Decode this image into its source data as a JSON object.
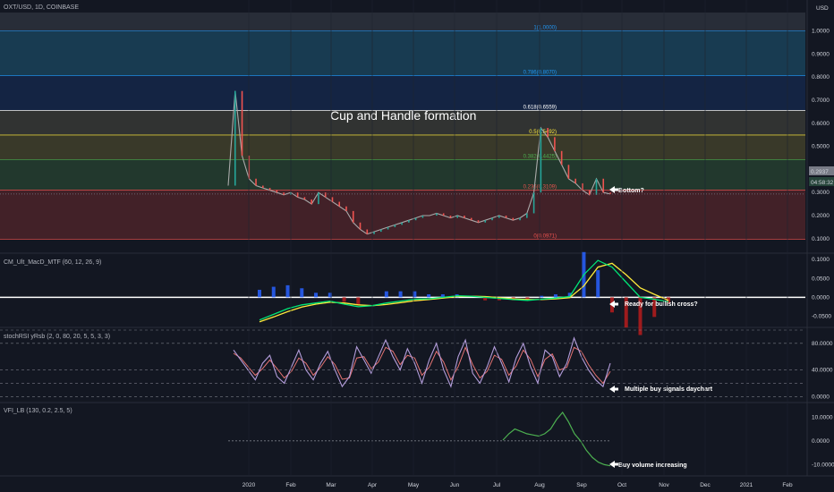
{
  "header": {
    "symbol": "OXT/USD, 1D, COINBASE",
    "currency": "USD"
  },
  "colors": {
    "bg": "#131722",
    "grid": "#1f2430",
    "price": "#aaaaaa",
    "candle_up": "#26a69a",
    "candle_down": "#ef5350",
    "macd_up": "#00e676",
    "macd_down": "#f44336",
    "signal": "#ffeb3b",
    "hist_pos": "#2962ff",
    "hist_neg": "#b71c1c",
    "stoch_k": "#b39ddb",
    "stoch_d": "#e57373",
    "vfi": "#4caf50"
  },
  "chart_data": [
    {
      "type": "line",
      "panel": "price",
      "title": "Cup and Handle formation",
      "y_ticks": [
        "1.0000",
        "0.9000",
        "0.8000",
        "0.7000",
        "0.6000",
        "0.5000",
        "0.4000",
        "0.3000",
        "0.2000",
        "0.1000"
      ],
      "ylim": [
        0.08,
        1.08
      ],
      "x_labels": [
        "2020",
        "Feb",
        "Mar",
        "Apr",
        "May",
        "Jun",
        "Jul",
        "Aug",
        "Sep",
        "Oct",
        "Nov",
        "Dec",
        "2021",
        "Feb"
      ],
      "fib_levels": [
        {
          "label": "1(1.0000)",
          "value": 1.0,
          "color": "#2196f3"
        },
        {
          "label": "0.786(0.8070)",
          "value": 0.807,
          "color": "#2196f3"
        },
        {
          "label": "0.618(0.6559)",
          "value": 0.6559,
          "color": "#ffffff"
        },
        {
          "label": "0.5(0.5492)",
          "value": 0.5492,
          "color": "#ffeb3b"
        },
        {
          "label": "0.382(0.4425)",
          "value": 0.4425,
          "color": "#4caf50"
        },
        {
          "label": "0.236(0.3109)",
          "value": 0.3109,
          "color": "#ef5350"
        },
        {
          "label": "0(0.0971)",
          "value": 0.0971,
          "color": "#ef5350"
        }
      ],
      "series": [
        {
          "values": [
            0.33,
            0.74,
            0.46,
            0.36,
            0.33,
            0.32,
            0.31,
            0.3,
            0.29,
            0.3,
            0.28,
            0.27,
            0.25,
            0.3,
            0.28,
            0.26,
            0.24,
            0.22,
            0.17,
            0.14,
            0.12,
            0.13,
            0.14,
            0.15,
            0.16,
            0.17,
            0.18,
            0.19,
            0.2,
            0.2,
            0.21,
            0.2,
            0.19,
            0.2,
            0.19,
            0.18,
            0.17,
            0.18,
            0.19,
            0.2,
            0.19,
            0.18,
            0.19,
            0.21,
            0.3,
            0.58,
            0.54,
            0.48,
            0.42,
            0.36,
            0.34,
            0.31,
            0.29,
            0.36,
            0.3,
            0.2937
          ]
        }
      ],
      "current_price": "0.2937",
      "countdown": "04:58:32",
      "annotation": "Bottom?"
    },
    {
      "type": "line",
      "panel": "macd",
      "title": "CM_Ult_MacD_MTF (60, 12, 26, 9)",
      "y_ticks": [
        "0.1000",
        "0.0500",
        "0.0000",
        "-0.0500"
      ],
      "ylim": [
        -0.075,
        0.11
      ],
      "series": [
        {
          "values": [
            -0.06,
            -0.045,
            -0.03,
            -0.02,
            -0.015,
            -0.01,
            -0.018,
            -0.025,
            -0.022,
            -0.015,
            -0.01,
            -0.005,
            -0.004,
            0.0,
            0.004,
            0.003,
            0.0,
            -0.003,
            -0.006,
            -0.008,
            -0.005,
            -0.002,
            0.002,
            0.06,
            0.098,
            0.08,
            0.04,
            0.0,
            -0.005,
            -0.012
          ]
        },
        {
          "values": [
            -0.065,
            -0.052,
            -0.038,
            -0.026,
            -0.018,
            -0.013,
            -0.015,
            -0.02,
            -0.022,
            -0.019,
            -0.014,
            -0.009,
            -0.006,
            -0.002,
            0.002,
            0.003,
            0.002,
            -0.001,
            -0.004,
            -0.006,
            -0.006,
            -0.004,
            -0.001,
            0.03,
            0.08,
            0.09,
            0.06,
            0.025,
            0.008,
            -0.008
          ]
        }
      ],
      "annotation": "Ready for bullish cross?"
    },
    {
      "type": "line",
      "panel": "stochrsi",
      "title": "stochRSI yRsb (2, 0, 80, 20, 5, 5, 3, 3)",
      "y_ticks": [
        "80.0000",
        "40.0000",
        "0.0000"
      ],
      "ylim": [
        -5,
        100
      ],
      "series": [
        {
          "values": [
            70,
            55,
            40,
            25,
            50,
            62,
            30,
            20,
            45,
            70,
            40,
            25,
            50,
            68,
            40,
            15,
            30,
            75,
            55,
            35,
            60,
            85,
            60,
            40,
            72,
            50,
            20,
            55,
            80,
            40,
            15,
            60,
            85,
            35,
            20,
            45,
            75,
            50,
            22,
            58,
            80,
            45,
            20,
            70,
            60,
            30,
            50,
            88,
            60,
            40,
            25,
            15,
            50
          ]
        },
        {
          "values": [
            65,
            58,
            45,
            32,
            42,
            55,
            42,
            28,
            38,
            58,
            50,
            32,
            44,
            60,
            48,
            26,
            28,
            58,
            60,
            42,
            52,
            74,
            68,
            48,
            62,
            58,
            32,
            44,
            68,
            52,
            25,
            45,
            74,
            48,
            28,
            38,
            62,
            56,
            32,
            46,
            70,
            56,
            30,
            56,
            64,
            40,
            44,
            74,
            68,
            48,
            32,
            20,
            38
          ]
        }
      ],
      "annotation": "Multiple buy signals daychart"
    },
    {
      "type": "line",
      "panel": "vfi",
      "title": "VFI_LB (130, 0.2, 2.5, 5)",
      "y_ticks": [
        "10.0000",
        "0.0000",
        "-10.0000"
      ],
      "ylim": [
        -14,
        15
      ],
      "series": [
        {
          "values": [
            0.3,
            3,
            5,
            4,
            3,
            2.5,
            2,
            3,
            5,
            9,
            12,
            8,
            3,
            0,
            -4,
            -7,
            -9,
            -10,
            -10.5
          ]
        }
      ],
      "annotation": "Buy volume increasing"
    }
  ]
}
